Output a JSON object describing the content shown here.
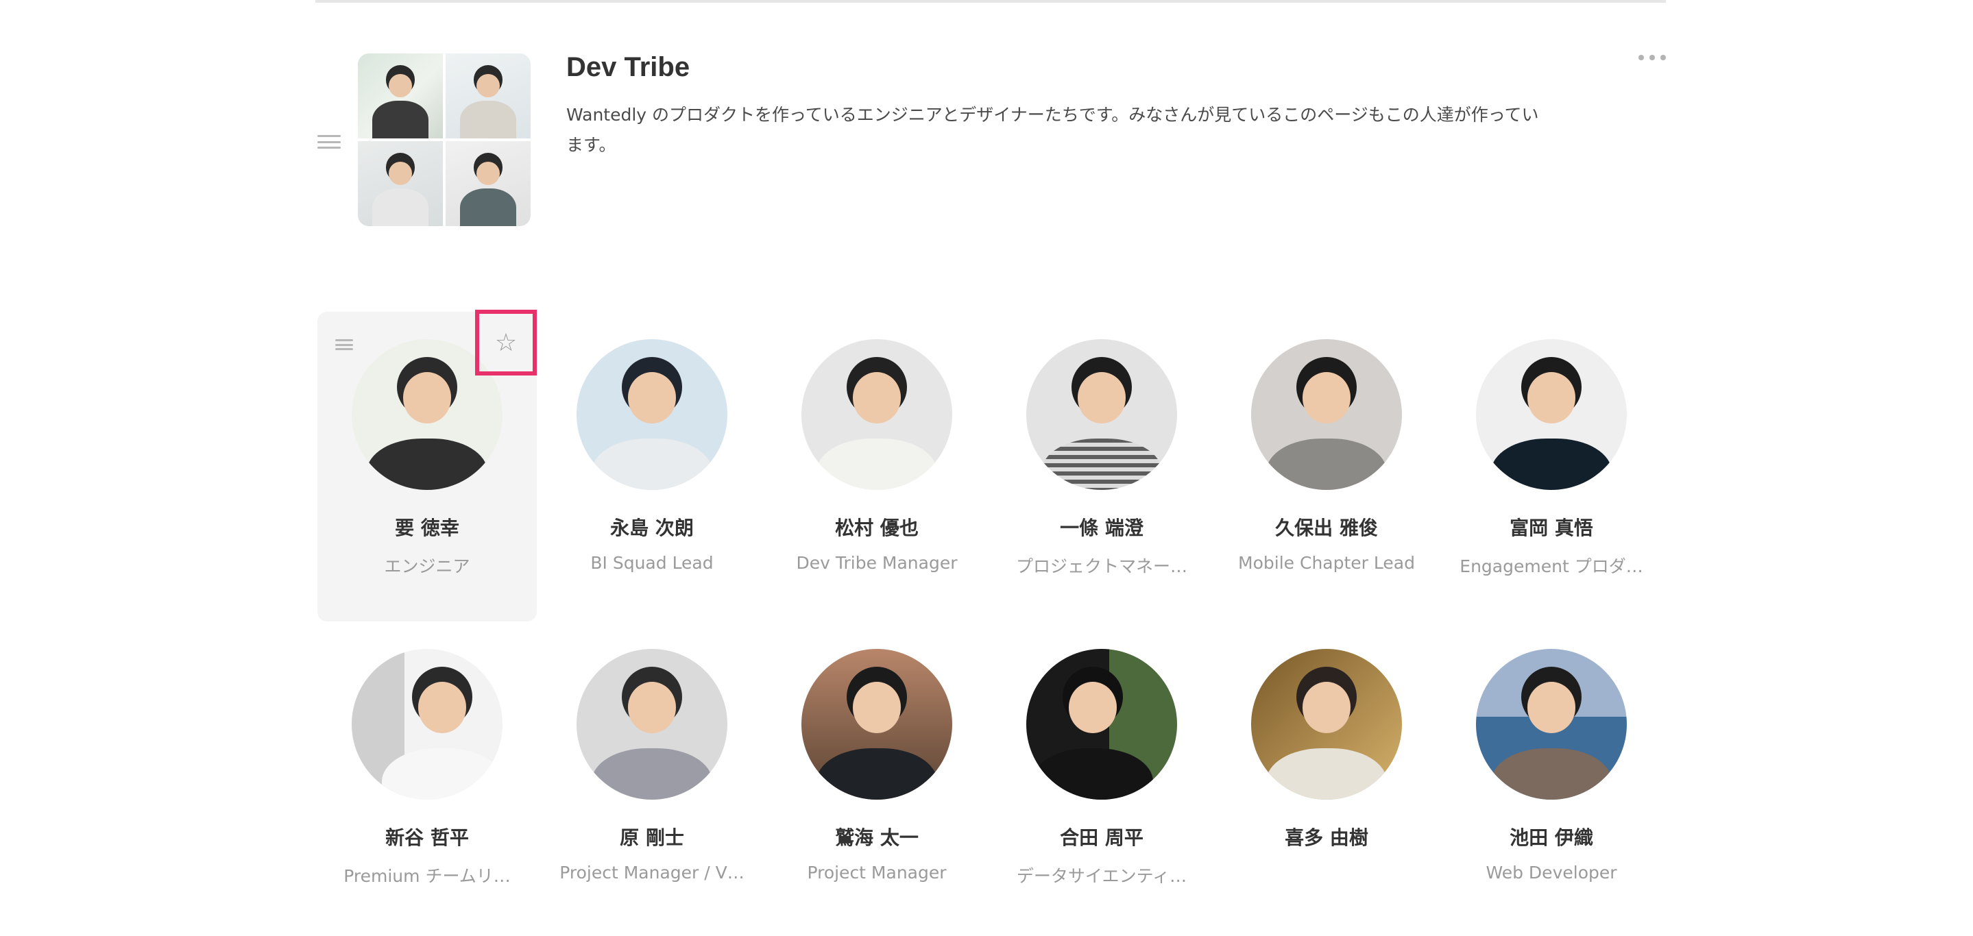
{
  "team": {
    "title": "Dev Tribe",
    "description": "Wantedly のプロダクトを作っているエンジニアとデザイナーたちです。みなさんが見ているこのページもこの人達が作っています。"
  },
  "icons": {
    "star": "☆",
    "drag_handle": "hamburger-icon",
    "more": "more-horizontal-icon"
  },
  "colors": {
    "selected_card_bg": "#f4f4f4",
    "highlight_border": "#e8306b",
    "role_text": "#9a9a9a"
  },
  "members": [
    {
      "name": "要 徳幸",
      "role": "エンジニア",
      "selected": true
    },
    {
      "name": "永島 次朗",
      "role": "BI Squad Lead"
    },
    {
      "name": "松村 優也",
      "role": "Dev Tribe Manager"
    },
    {
      "name": "一條 端澄",
      "role": "プロジェクトマネー…"
    },
    {
      "name": "久保出 雅俊",
      "role": "Mobile Chapter Lead"
    },
    {
      "name": "富岡 真悟",
      "role": "Engagement プロダ…"
    },
    {
      "name": "新谷 哲平",
      "role": "Premium チームリ…"
    },
    {
      "name": "原 剛士",
      "role": "Project Manager / V…"
    },
    {
      "name": "鷲海 太一",
      "role": "Project Manager"
    },
    {
      "name": "合田 周平",
      "role": "データサイエンティ…"
    },
    {
      "name": "喜多 由樹",
      "role": ""
    },
    {
      "name": "池田 伊織",
      "role": "Web Developer"
    }
  ]
}
